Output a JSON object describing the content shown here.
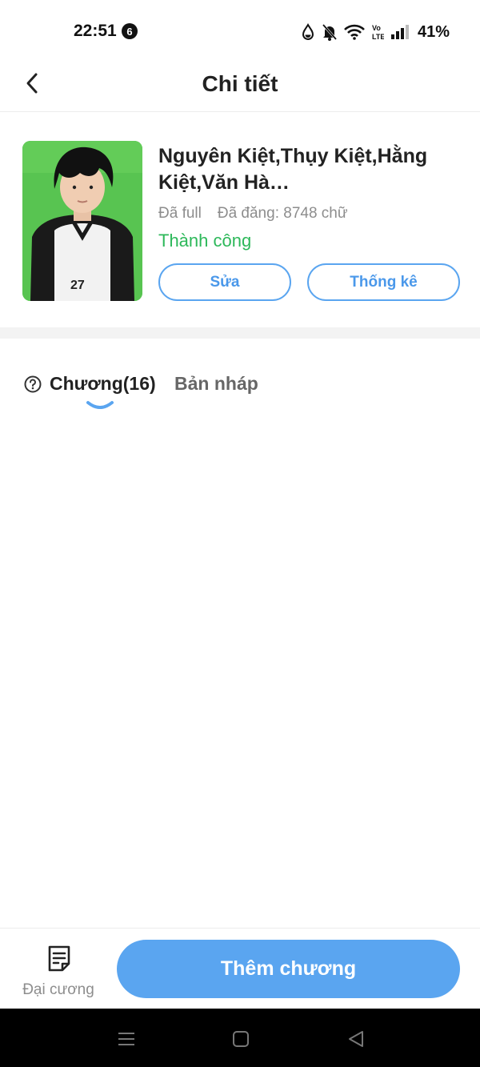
{
  "status_bar": {
    "time": "22:51",
    "notification_count": "6",
    "battery": "41%",
    "icons": [
      "water-drop-icon",
      "bell-off-icon",
      "wifi-icon",
      "volte-icon",
      "signal-icon"
    ]
  },
  "header": {
    "title": "Chi tiết",
    "back_icon": "chevron-left-icon"
  },
  "book": {
    "title": "Nguyên Kiệt,Thụy Kiệt,Hằng Kiệt,Văn Hà…",
    "completion": "Đã full",
    "word_count": "Đã đăng: 8748 chữ",
    "status": "Thành công",
    "edit_label": "Sửa",
    "stats_label": "Thống kê",
    "cover_colors": {
      "background": "#58c451",
      "jersey": "#f2f2f2",
      "sleeve": "#1a1a1a"
    }
  },
  "tabs": {
    "chapters_label": "Chương(16)",
    "drafts_label": "Bản nháp",
    "help_icon": "question-circle-icon"
  },
  "bottom": {
    "outline_label": "Đại cương",
    "outline_icon": "document-icon",
    "add_chapter_label": "Thêm chương"
  },
  "colors": {
    "accent": "#5aa5f0",
    "success": "#2db85a",
    "muted": "#8d8d8d"
  },
  "nav_bar": {
    "icons": [
      "menu-icon",
      "home-icon",
      "back-triangle-icon"
    ]
  }
}
